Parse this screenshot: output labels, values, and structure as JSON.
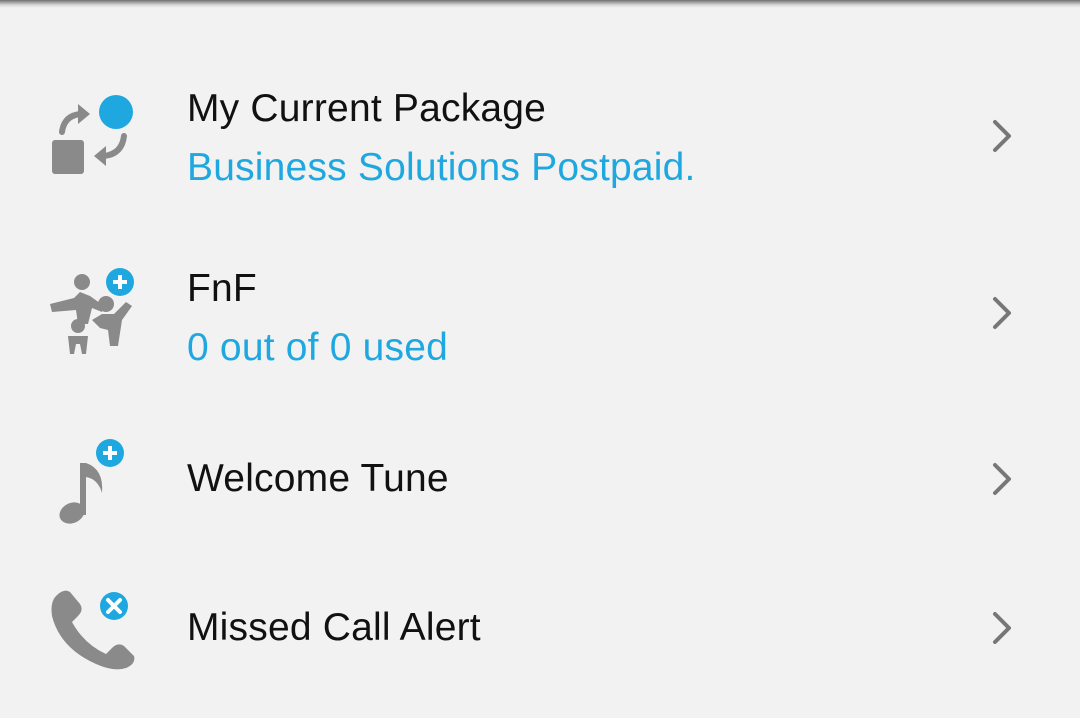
{
  "colors": {
    "background": "#f2f2f2",
    "title_text": "#111111",
    "subtitle_text": "#1fa8e0",
    "icon_gray": "#8a8a8a",
    "icon_accent": "#1fa8e0",
    "chevron": "#777777"
  },
  "menu": {
    "items": [
      {
        "icon": "package-switch-icon",
        "title": "My Current Package",
        "subtitle": "Business Solutions Postpaid."
      },
      {
        "icon": "fnf-add-icon",
        "title": "FnF",
        "subtitle": "0 out of 0 used"
      },
      {
        "icon": "music-note-add-icon",
        "title": "Welcome Tune"
      },
      {
        "icon": "missed-call-icon",
        "title": "Missed Call Alert"
      }
    ]
  }
}
